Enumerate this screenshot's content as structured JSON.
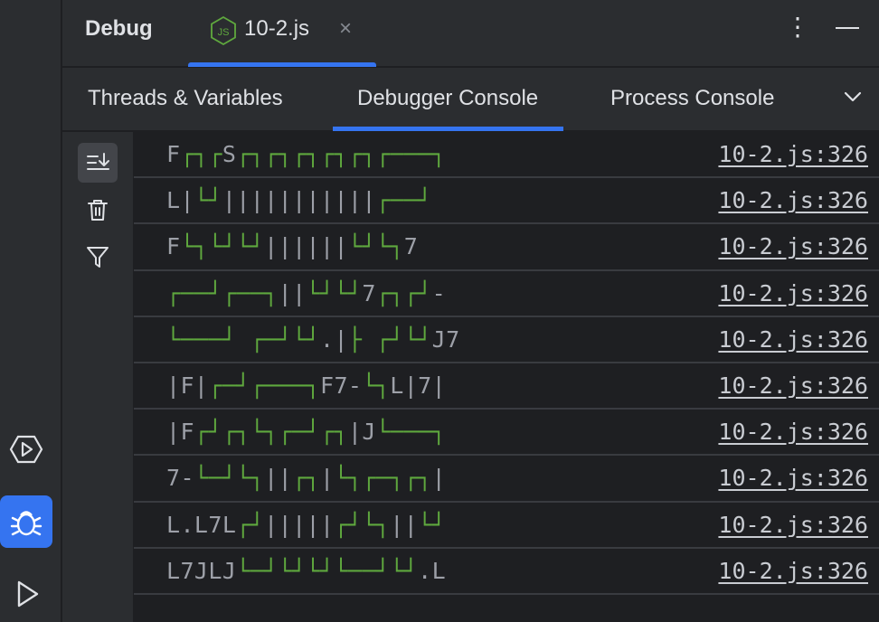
{
  "header": {
    "panel_title": "Debug",
    "file_tab": {
      "label": "10-2.js",
      "badge_text": "JS",
      "close_label": "×"
    },
    "kebab_label": "⋮"
  },
  "subtabs": [
    {
      "label": "Threads & Variables",
      "active": false
    },
    {
      "label": "Debugger Console",
      "active": true
    },
    {
      "label": "Process Console",
      "active": false
    }
  ],
  "toolbar_icons": [
    "scroll-to-end-icon",
    "trash-icon",
    "filter-icon"
  ],
  "left_stripe_icons": [
    "services-icon",
    "debug-icon",
    "run-icon"
  ],
  "colors": {
    "accent": "#3574f0",
    "green": "#5fa83e",
    "text": "#dfe1e5",
    "muted": "#9da0a8"
  },
  "console_rows": [
    {
      "text": "F┌┐┌S┌┐┌┐┌┐┌┐┌┐┌───┐",
      "link": "10-2.js:326"
    },
    {
      "text": "L|└┘|||||||||||┌──┘",
      "link": "10-2.js:326"
    },
    {
      "text": "F└┐└┘└┘||||||└┘└┐7",
      "link": "10-2.js:326"
    },
    {
      "text": "┌──┘┌──┐||└┘└┘7┌┐┌┘-",
      "link": "10-2.js:326"
    },
    {
      "text": "└───┘ ┌─┘└┘.|├ ┌┘└┘J7",
      "link": "10-2.js:326"
    },
    {
      "text": "|F|┌─┘┌───┐F7-└┐L|7|",
      "link": "10-2.js:326"
    },
    {
      "text": "|F┌┘┌┐└┐┌─┘┌┐|J└───┐",
      "link": "10-2.js:326"
    },
    {
      "text": "7-└─┘└┐||┌┐|└┐┌─┐┌┐|",
      "link": "10-2.js:326"
    },
    {
      "text": "L.L7L┌┘|||||┌┘└┐||└┘",
      "link": "10-2.js:326"
    },
    {
      "text": "L7JLJ└─┘└┘└┘└──┘└┘.L",
      "link": "10-2.js:326"
    }
  ]
}
